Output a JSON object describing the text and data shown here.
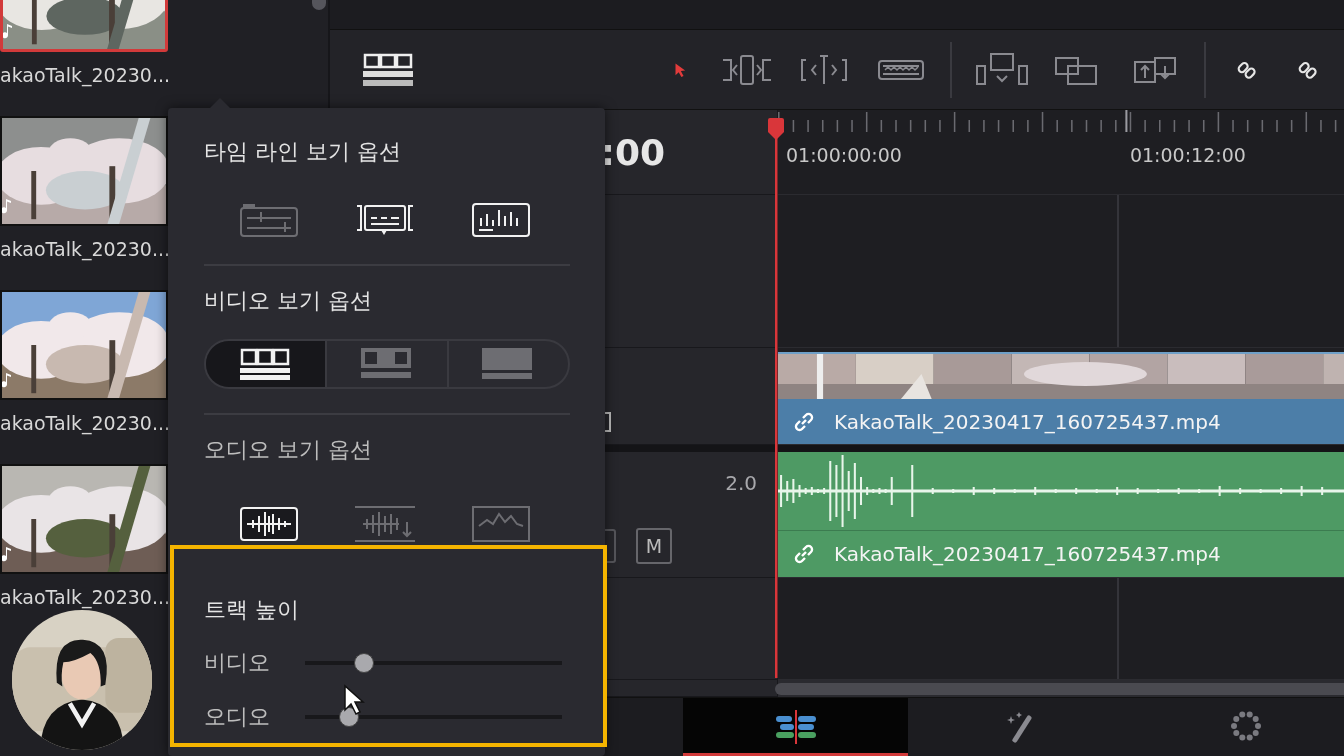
{
  "media_pool": {
    "clips": [
      {
        "label": "akaoTalk_20230...",
        "selected": true
      },
      {
        "label": "akaoTalk_20230...",
        "selected": false
      },
      {
        "label": "akaoTalk_20230...",
        "selected": false
      },
      {
        "label": "akaoTalk_20230...",
        "selected": false
      }
    ]
  },
  "toolbar": {
    "edit_tools": [
      {
        "kind": "select",
        "selected": true
      },
      {
        "kind": "trim",
        "selected": false
      },
      {
        "kind": "dynamic-trim",
        "selected": false
      },
      {
        "kind": "blade",
        "selected": false
      }
    ],
    "edit_modes": [
      {
        "kind": "insert"
      },
      {
        "kind": "overwrite"
      },
      {
        "kind": "replace"
      }
    ],
    "link_tools": [
      {
        "kind": "link"
      },
      {
        "kind": "link"
      }
    ]
  },
  "timeline": {
    "timecode": ":00",
    "ruler": [
      "01:00:00:00",
      "01:00:12:00"
    ],
    "video_track": {
      "clip": "KakaoTalk_20230417_160725437.mp4"
    },
    "audio_track": {
      "channels": "2.0",
      "mute": "M",
      "clip": "KakaoTalk_20230417_160725437.mp4"
    }
  },
  "popup": {
    "sections": [
      {
        "kind": "toggles",
        "title": "타임 라인 보기 옵션",
        "options": [
          {
            "kind": "stacked",
            "on": false
          },
          {
            "kind": "subtitles",
            "on": true
          },
          {
            "kind": "meters",
            "on": true
          }
        ]
      },
      {
        "kind": "segmented",
        "title": "비디오 보기 옵션",
        "options": [
          {
            "kind": "filmstrip",
            "selected": true
          },
          {
            "kind": "thumbnail",
            "selected": false
          },
          {
            "kind": "simple",
            "selected": false
          }
        ]
      },
      {
        "kind": "choices",
        "title": "오디오 보기 옵션",
        "options": [
          {
            "kind": "waveform",
            "selected": true
          },
          {
            "kind": "waveform-down",
            "selected": false
          },
          {
            "kind": "envelope",
            "selected": false
          }
        ]
      }
    ],
    "track_height": {
      "title": "트랙 높이",
      "sliders": [
        {
          "label": "비디오",
          "level": 0.23
        },
        {
          "label": "오디오",
          "level": 0.17
        }
      ]
    }
  },
  "page_tabs": [
    {
      "kind": "edit",
      "selected": true
    },
    {
      "kind": "fusion",
      "selected": false
    },
    {
      "kind": "color",
      "selected": false
    }
  ]
}
